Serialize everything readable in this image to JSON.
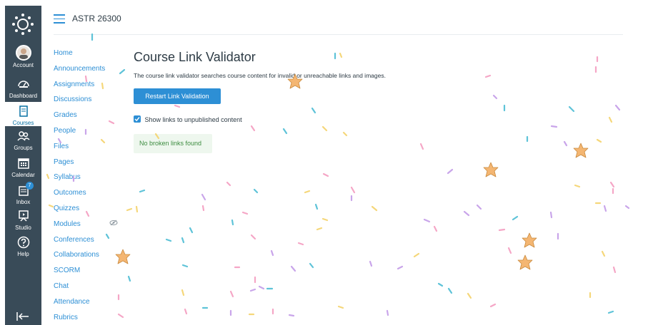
{
  "global_nav": {
    "items": [
      {
        "label": "Account",
        "icon": "user-avatar"
      },
      {
        "label": "Dashboard",
        "icon": "dashboard-icon"
      },
      {
        "label": "Courses",
        "icon": "courses-icon",
        "active": true
      },
      {
        "label": "Groups",
        "icon": "groups-icon"
      },
      {
        "label": "Calendar",
        "icon": "calendar-icon"
      },
      {
        "label": "Inbox",
        "icon": "inbox-icon",
        "badge": "7"
      },
      {
        "label": "Studio",
        "icon": "studio-icon"
      },
      {
        "label": "Help",
        "icon": "help-icon"
      }
    ],
    "colors": {
      "background": "#394b58",
      "active_text": "#0770a3"
    }
  },
  "header": {
    "breadcrumb": "ASTR 26300"
  },
  "course_nav": {
    "items": [
      "Home",
      "Announcements",
      "Assignments",
      "Discussions",
      "Grades",
      "People",
      "Files",
      "Pages",
      "Syllabus",
      "Outcomes",
      "Quizzes",
      "Modules",
      "Conferences",
      "Collaborations",
      "SCORM",
      "Chat",
      "Attendance",
      "Rubrics"
    ]
  },
  "main": {
    "title": "Course Link Validator",
    "description": "The course link validator searches course content for invalid or unreachable links and images.",
    "button_label": "Restart Link Validation",
    "checkbox_label": "Show links to unpublished content",
    "checkbox_checked": true,
    "result_text": "No broken links found"
  },
  "colors": {
    "accent": "#2d8fd5",
    "success_bg": "#eef7ee",
    "success_text": "#3d8c40"
  }
}
